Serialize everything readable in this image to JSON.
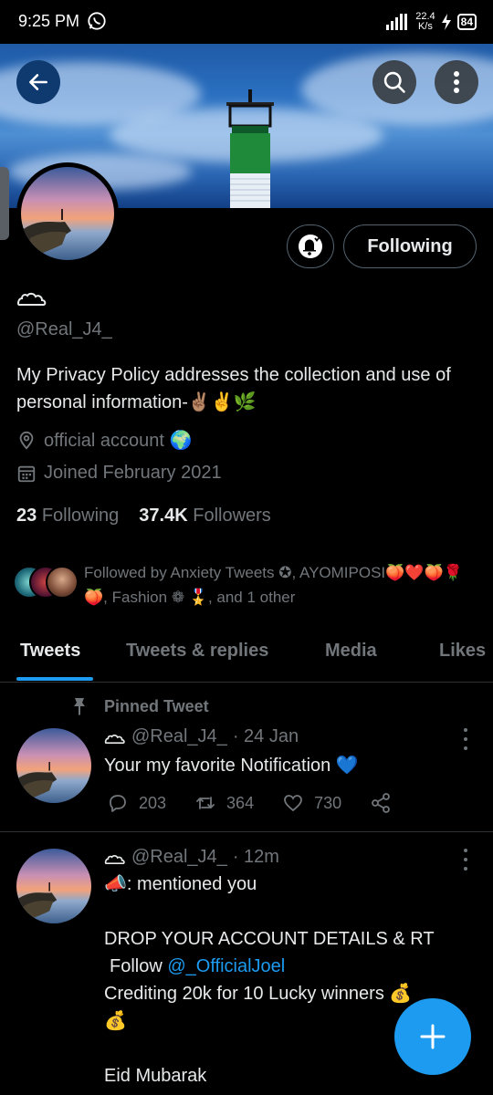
{
  "status_bar": {
    "time": "9:25 PM",
    "net_speed_value": "22.4",
    "net_speed_unit": "K/s",
    "battery": "84"
  },
  "profile": {
    "handle": "@Real_J4_",
    "bio": "My Privacy Policy addresses the collection and use of personal information-✌🏽✌️🌿",
    "location": "official account 🌍",
    "joined": "Joined February 2021",
    "following_count": "23",
    "following_label": "Following",
    "followers_count": "37.4K",
    "followers_label": "Followers",
    "follow_button_label": "Following",
    "followed_by": "Followed by Anxiety Tweets ✪, AYOMIPOSI🍑❤️🍑🌹🍑, Fashion ❁ 🎖️, and 1 other"
  },
  "tabs": [
    {
      "label": "Tweets"
    },
    {
      "label": "Tweets & replies"
    },
    {
      "label": "Media"
    },
    {
      "label": "Likes"
    }
  ],
  "tweets": [
    {
      "pinned_label": "Pinned Tweet",
      "handle": "@Real_J4_",
      "time": "· 24 Jan",
      "text": "Your my favorite Notification 💙",
      "replies": "203",
      "retweets": "364",
      "likes": "730"
    },
    {
      "handle": "@Real_J4_",
      "time": "· 12m",
      "line1": "📣: mentioned you",
      "line2": "DROP YOUR ACCOUNT DETAILS & RT",
      "follow_prefix": "Follow ",
      "mention": "@_OfficialJoel",
      "line4": "Crediting 20k for 10 Lucky winners 💰",
      "line5": "💰",
      "line6": "Eid Mubarak"
    }
  ],
  "icons": {
    "back": "back-arrow-icon",
    "search": "search-icon",
    "more": "more-vertical-icon",
    "bell": "notification-bell-icon",
    "location": "location-pin-icon",
    "calendar": "calendar-icon",
    "pin": "pin-icon",
    "reply": "reply-icon",
    "retweet": "retweet-icon",
    "like": "heart-icon",
    "share": "share-icon",
    "compose": "compose-plus-icon"
  },
  "colors": {
    "accent": "#1d9bf0",
    "background": "#000000",
    "text_primary": "#e7e9ea",
    "text_secondary": "#71767b",
    "border": "#2f3336"
  }
}
